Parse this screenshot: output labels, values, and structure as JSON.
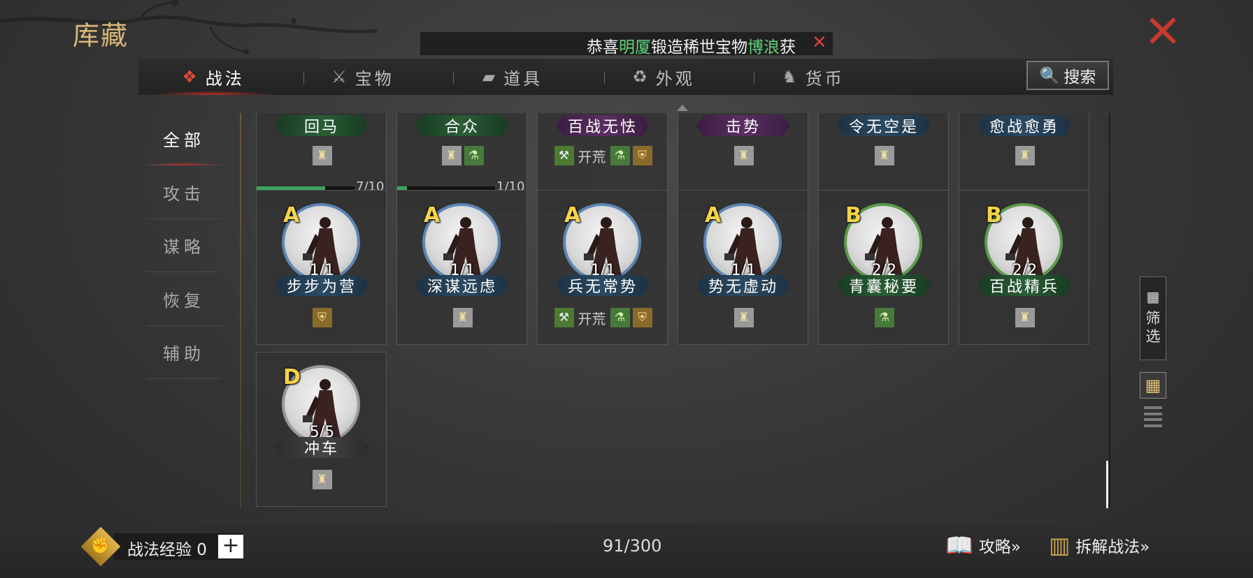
{
  "title": "库藏",
  "ticker": {
    "prefix": "恭喜",
    "player": "明厦",
    "middle": "锻造稀世宝物",
    "item": "博浪",
    "suffix": "获"
  },
  "tabs": [
    {
      "label": "战法",
      "icon": "skill-scroll-icon",
      "glyph": "❖",
      "active": true
    },
    {
      "label": "宝物",
      "icon": "treasure-icon",
      "glyph": "⚔",
      "active": false
    },
    {
      "label": "道具",
      "icon": "item-box-icon",
      "glyph": "▰",
      "active": false
    },
    {
      "label": "外观",
      "icon": "appearance-icon",
      "glyph": "♻",
      "active": false
    },
    {
      "label": "货币",
      "icon": "currency-bag-icon",
      "glyph": "♞",
      "active": false
    }
  ],
  "search_label": "搜索",
  "categories": [
    {
      "label": "全部",
      "active": true
    },
    {
      "label": "攻击",
      "active": false
    },
    {
      "label": "谋略",
      "active": false
    },
    {
      "label": "恢复",
      "active": false
    },
    {
      "label": "辅助",
      "active": false
    }
  ],
  "cards": [
    {
      "name": "回马",
      "plate": "green",
      "partial": true,
      "icons": [
        "bag"
      ],
      "progress": {
        "fraction": 0.7,
        "text": "7/10"
      }
    },
    {
      "name": "合众",
      "plate": "green",
      "partial": true,
      "icons": [
        "bag",
        "pot"
      ],
      "progress": {
        "fraction": 0.1,
        "text": "1/10"
      }
    },
    {
      "name": "百战无怯",
      "plate": "purple",
      "partial": true,
      "icons": [
        "axe",
        "kaihuang",
        "pot",
        "shield"
      ]
    },
    {
      "name": "击势",
      "plate": "purple",
      "partial": true,
      "icons": [
        "bag"
      ]
    },
    {
      "name": "令无空是",
      "plate": "blue",
      "partial": true,
      "icons": [
        "bag"
      ]
    },
    {
      "name": "愈战愈勇",
      "plate": "blue",
      "partial": true,
      "icons": [
        "bag"
      ]
    },
    {
      "grade": "A",
      "count": "1/1",
      "name": "步步为营",
      "plate": "blue",
      "border": "blue",
      "icons": [
        "shield"
      ]
    },
    {
      "grade": "A",
      "count": "1/1",
      "name": "深谋远虑",
      "plate": "blue",
      "border": "blue",
      "icons": [
        "bag"
      ]
    },
    {
      "grade": "A",
      "count": "1/1",
      "name": "兵无常势",
      "plate": "blue",
      "border": "blue",
      "icons": [
        "axe",
        "kaihuang",
        "pot",
        "shield"
      ]
    },
    {
      "grade": "A",
      "count": "1/1",
      "name": "势无虚动",
      "plate": "blue",
      "border": "blue",
      "icons": [
        "bag"
      ]
    },
    {
      "grade": "B",
      "count": "2/2",
      "name": "青囊秘要",
      "plate": "green",
      "border": "green",
      "icons": [
        "pot"
      ]
    },
    {
      "grade": "B",
      "count": "2/2",
      "name": "百战精兵",
      "plate": "green",
      "border": "green",
      "icons": [
        "bag"
      ]
    },
    {
      "grade": "D",
      "count": "5/5",
      "name": "冲车",
      "plate": "grey",
      "border": "grey",
      "icons": [
        "bag"
      ]
    }
  ],
  "kaihuang_label": "开荒",
  "filter_label": "筛选",
  "bottom": {
    "exp_label": "战法经验 0",
    "plus": "+",
    "capacity": "91/300",
    "guide_label": "攻略»",
    "dismantle_label": "拆解战法»"
  }
}
